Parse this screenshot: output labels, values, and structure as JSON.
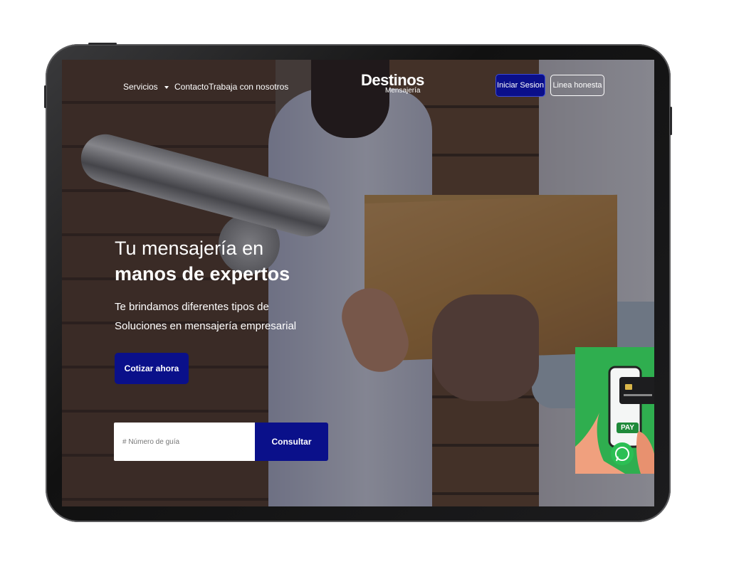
{
  "nav": {
    "items": [
      {
        "label": "Servicios"
      },
      {
        "label": "Contacto"
      },
      {
        "label": "Trabaja con nosotros"
      }
    ],
    "logo": {
      "main": "Destinos",
      "sub": "Mensajería"
    },
    "login_label": "Iniciar Sesion",
    "ethics_label": "Linea honesta"
  },
  "hero": {
    "line1": "Tu mensajería en",
    "line2": "manos de expertos",
    "subtitle": "Te brindamos diferentes tipos de Soluciones en mensajería empresarial",
    "cta_label": "Cotizar ahora"
  },
  "tracking": {
    "placeholder": "# Número de guía",
    "button_label": "Consultar"
  },
  "promo": {
    "pay_label": "PAY",
    "icons": [
      "phone-icon",
      "credit-card-icon",
      "whatsapp-icon"
    ]
  },
  "colors": {
    "brand_blue": "#0a108a",
    "promo_green": "#2fae4f"
  }
}
